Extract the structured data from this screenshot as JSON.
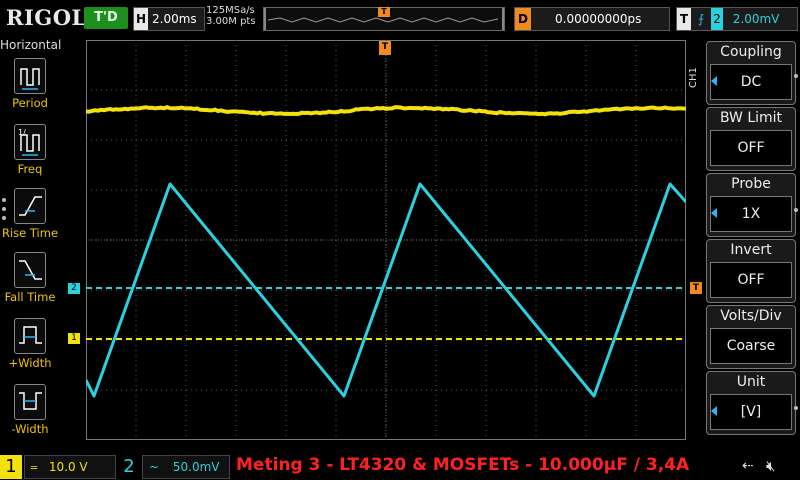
{
  "header": {
    "logo": "RIGOL",
    "run_status": "T'D",
    "timebase_key": "H",
    "timebase_value": "2.00ms",
    "sample_rate": "125MSa/s",
    "memory_depth": "3.00M pts",
    "trigger_marker": "T",
    "delay_key": "D",
    "delay_value": "0.00000000ps",
    "trigger_key": "T",
    "trigger_edge_icon": "rising-edge-icon",
    "trigger_source": "2",
    "trigger_level": "2.00mV"
  },
  "left_menu": {
    "title": "Horizontal",
    "items": [
      {
        "label": "Period",
        "icon": "period-icon"
      },
      {
        "label": "Freq",
        "icon": "frequency-icon"
      },
      {
        "label": "Rise Time",
        "icon": "rise-time-icon"
      },
      {
        "label": "Fall Time",
        "icon": "fall-time-icon"
      },
      {
        "label": "+Width",
        "icon": "positive-width-icon"
      },
      {
        "label": "-Width",
        "icon": "negative-width-icon"
      }
    ]
  },
  "right_menu": {
    "channel_tab": "CH1",
    "items": [
      {
        "title": "Coupling",
        "value": "DC",
        "has_arrow": true
      },
      {
        "title": "BW Limit",
        "value": "OFF",
        "has_arrow": false
      },
      {
        "title": "Probe",
        "value": "1X",
        "has_arrow": true
      },
      {
        "title": "Invert",
        "value": "OFF",
        "has_arrow": false
      },
      {
        "title": "Volts/Div",
        "value": "Coarse",
        "has_arrow": false
      },
      {
        "title": "Unit",
        "value": "[V]",
        "has_arrow": true
      }
    ]
  },
  "screen": {
    "ch1_marker": "1",
    "ch2_marker": "2",
    "trigger_level_marker": "T",
    "trigger_pos_marker": "T",
    "colors": {
      "ch1": "#f3e10c",
      "ch2": "#2ad2e0",
      "trigger": "#f08a1d",
      "grid": "#5a5a5a"
    }
  },
  "footer": {
    "ch1_number": "1",
    "ch1_coupling_icon": "dc-coupling-icon",
    "ch1_scale": "10.0 V",
    "ch2_number": "2",
    "ch2_coupling_icon": "ac-coupling-icon",
    "ch2_scale": "50.0mV",
    "caption": "Meting 3 - LT4320 & MOSFETs - 10.000µF / 3,4A",
    "usb_icon": "usb-icon",
    "speaker_icon": "speaker-muted-icon"
  }
}
